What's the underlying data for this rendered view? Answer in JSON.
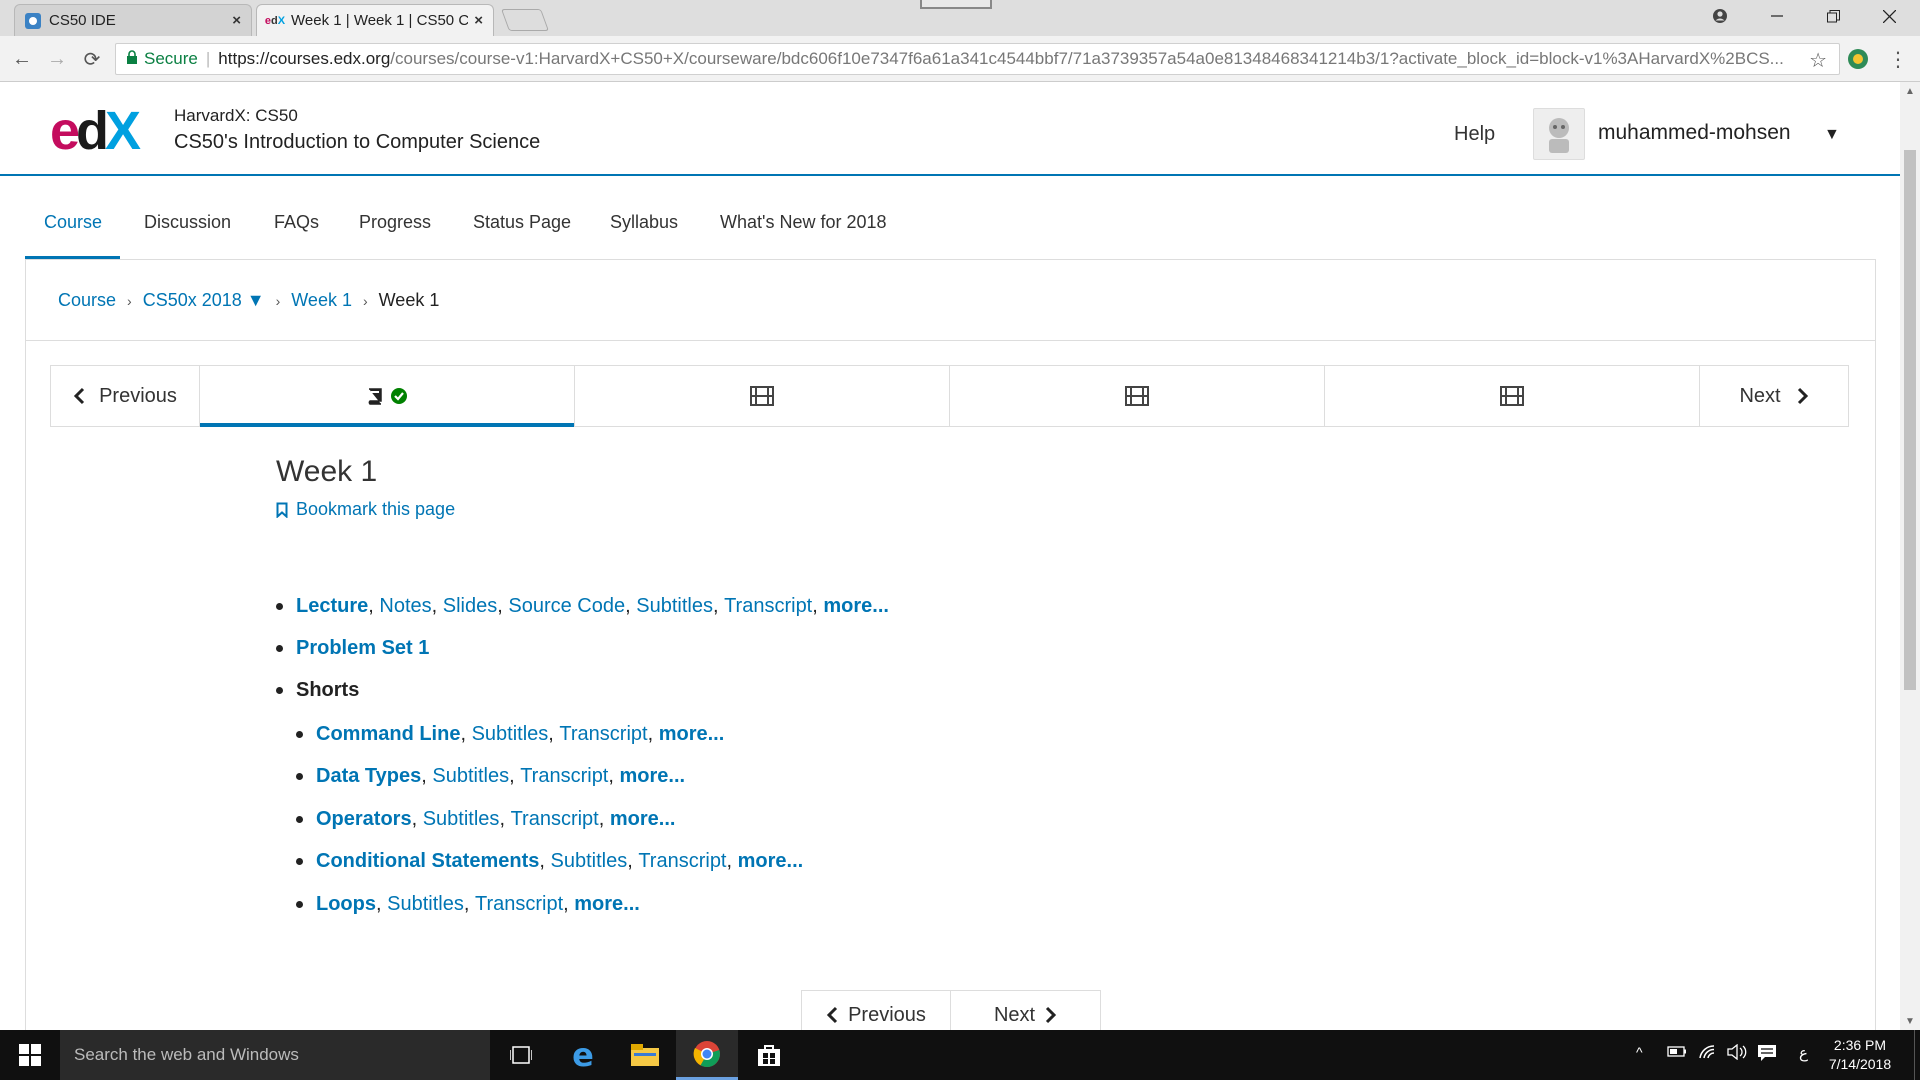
{
  "browser": {
    "tabs": [
      {
        "title": "CS50 IDE",
        "close": "×"
      },
      {
        "title": "Week 1 | Week 1 | CS50 C",
        "close": "×"
      }
    ],
    "nav": {
      "back": "←",
      "forward": "→",
      "reload": "⟳"
    },
    "omnibox": {
      "secure_label": "Secure",
      "url_host": "https://courses.edx.org",
      "url_rest": "/courses/course-v1:HarvardX+CS50+X/courseware/bdc606f10e7347f6a61a341c4544bbf7/71a3739357a54a0e81348468341214b3/1?activate_block_id=block-v1%3AHarvardX%2BCS..."
    }
  },
  "header": {
    "logo": {
      "e": "e",
      "d": "d",
      "x": "X"
    },
    "course_org": "HarvardX: CS50",
    "course_title": "CS50's Introduction to Computer Science",
    "help": "Help",
    "username": "muhammed-mohsen"
  },
  "course_tabs": [
    "Course",
    "Discussion",
    "FAQs",
    "Progress",
    "Status Page",
    "Syllabus",
    "What's New for 2018"
  ],
  "breadcrumb": {
    "course": "Course",
    "section": "CS50x 2018 ▼",
    "subsection": "Week 1",
    "current": "Week 1"
  },
  "sequence": {
    "previous": "Previous",
    "next": "Next"
  },
  "unit": {
    "title": "Week 1",
    "bookmark": "Bookmark this page"
  },
  "materials": {
    "lecture": {
      "title": "Lecture",
      "links": [
        "Notes",
        "Slides",
        "Source Code",
        "Subtitles",
        "Transcript"
      ],
      "more": "more..."
    },
    "problem_set": "Problem Set 1",
    "shorts_label": "Shorts",
    "shorts": [
      {
        "title": "Command Line",
        "links": [
          "Subtitles",
          "Transcript"
        ],
        "more": "more..."
      },
      {
        "title": "Data Types",
        "links": [
          "Subtitles",
          "Transcript"
        ],
        "more": "more..."
      },
      {
        "title": "Operators",
        "links": [
          "Subtitles",
          "Transcript"
        ],
        "more": "more..."
      },
      {
        "title": "Conditional Statements",
        "links": [
          "Subtitles",
          "Transcript"
        ],
        "more": "more..."
      },
      {
        "title": "Loops",
        "links": [
          "Subtitles",
          "Transcript"
        ],
        "more": "more..."
      }
    ]
  },
  "bottom_nav": {
    "previous": "Previous",
    "next": "Next"
  },
  "taskbar": {
    "search_placeholder": "Search the web and Windows",
    "language": "ع",
    "time": "2:36 PM",
    "date": "7/14/2018"
  },
  "colors": {
    "accent": "#0075b4",
    "logo_e": "#c40c5e",
    "logo_x": "#00a0e0"
  }
}
